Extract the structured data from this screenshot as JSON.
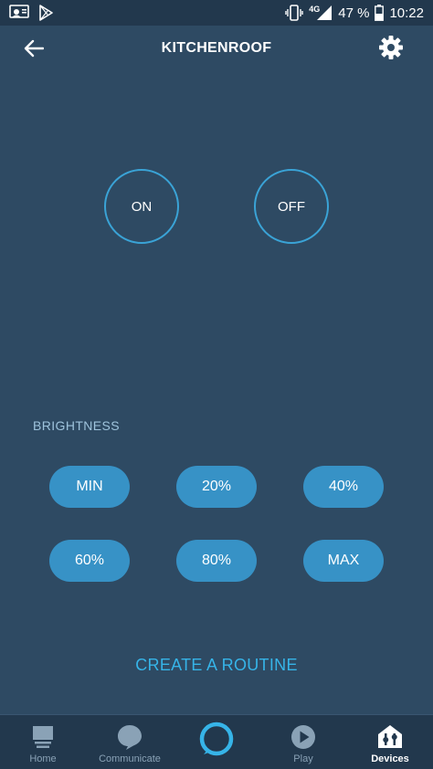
{
  "status_bar": {
    "network_type": "4G",
    "battery": "47 %",
    "time": "10:22"
  },
  "header": {
    "title": "KITCHENROOF"
  },
  "power": {
    "on_label": "ON",
    "off_label": "OFF"
  },
  "brightness": {
    "label": "BRIGHTNESS",
    "options": [
      "MIN",
      "20%",
      "40%",
      "60%",
      "80%",
      "MAX"
    ]
  },
  "routine": {
    "label": "CREATE A ROUTINE"
  },
  "nav": {
    "items": [
      {
        "label": "Home",
        "icon": "home-icon"
      },
      {
        "label": "Communicate",
        "icon": "communicate-icon"
      },
      {
        "label": "",
        "icon": "alexa-icon"
      },
      {
        "label": "Play",
        "icon": "play-icon"
      },
      {
        "label": "Devices",
        "icon": "devices-icon"
      }
    ],
    "active_index": 4
  },
  "colors": {
    "background": "#2e4a63",
    "bar_background": "#22384d",
    "accent": "#36b4e8",
    "pill": "#3792c6",
    "section_label": "#9ec3dc",
    "nav_inactive": "#8aa2b6"
  }
}
